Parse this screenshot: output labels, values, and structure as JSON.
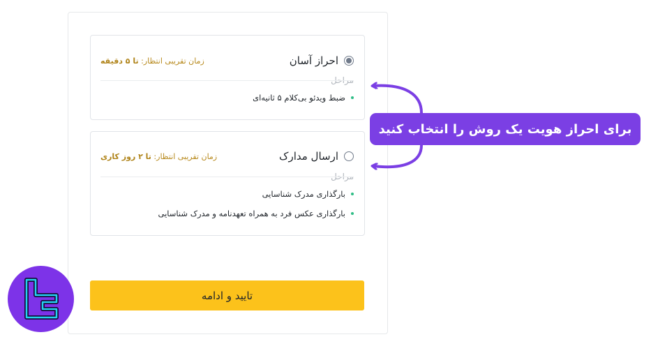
{
  "options": [
    {
      "title": "احراز آسان",
      "selected": true,
      "wait_label": "زمان تقریبی انتظار:",
      "wait_value": "تا ۵ دقیقه",
      "steps_label": "مراحل",
      "steps": [
        "ضبط ویدئو بی‌کلام ۵ ثانیه‌ای"
      ]
    },
    {
      "title": "ارسال مدارک",
      "selected": false,
      "wait_label": "زمان تقریبی انتظار:",
      "wait_value": "تا ۲ روز کاری",
      "steps_label": "مراحل",
      "steps": [
        "بارگذاری مدرک شناسایی",
        "بارگذاری عکس فرد به همراه تعهدنامه و مدرک شناسایی"
      ]
    }
  ],
  "confirm_button": "تایید و ادامه",
  "callout": "برای احراز هویت یک روش را انتخاب کنید",
  "colors": {
    "accent": "#fcc21b",
    "callout": "#7b3fe4",
    "wait_text": "#b7891c",
    "bullet": "#2ebd85",
    "logo_bg": "#7d33e8",
    "logo_stroke": "#22d3ee"
  }
}
